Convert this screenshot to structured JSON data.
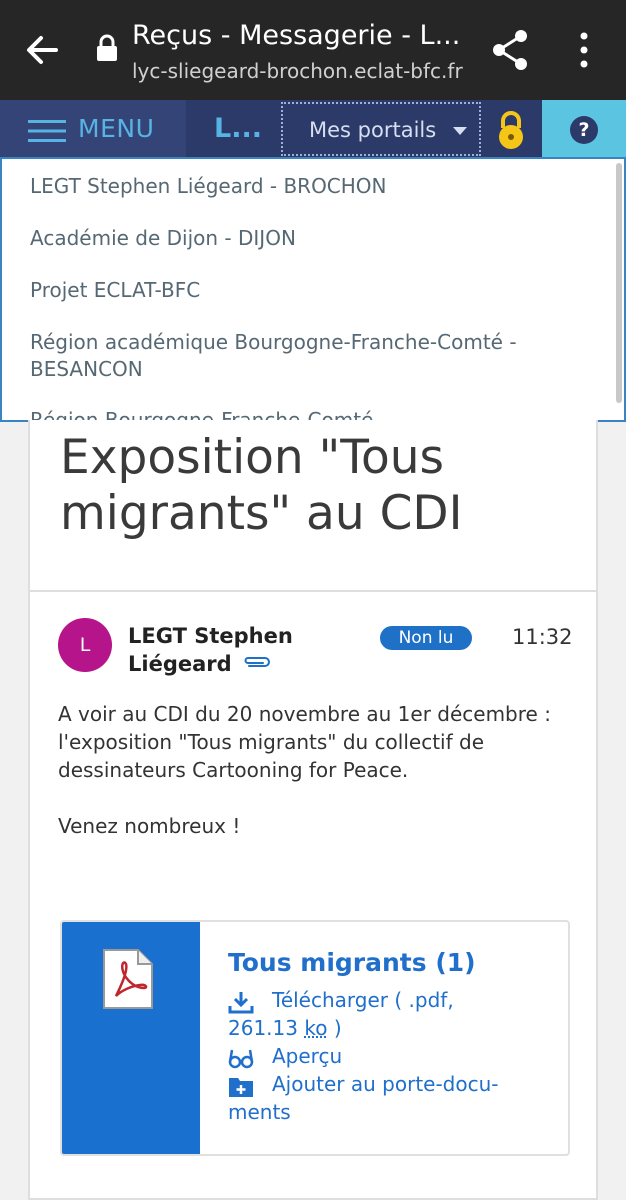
{
  "browser": {
    "title": "Reçus - Messagerie - L...",
    "url": "lyc-sliegeard-brochon.eclat-bfc.fr",
    "icons": [
      "arrow-back-icon",
      "lock-icon",
      "share-icon",
      "more-vert-icon"
    ]
  },
  "navbar": {
    "menu_label": "MENU",
    "short_label": "L...",
    "portals_label": "Mes portails",
    "help_label": "?"
  },
  "portals_dropdown": {
    "items": [
      "LEGT Stephen Liégeard - BROCHON",
      "Académie de Dijon - DIJON",
      "Projet ECLAT-BFC",
      "Région académique Bourgogne-Franche-Comté - BESANCON",
      "Région Bourgogne-Franche-Comté"
    ]
  },
  "message": {
    "subject": "Exposition \"Tous migrants\" au CDI",
    "avatar_initial": "L",
    "sender": "LEGT Stephen Liégeard",
    "status": "Non lu",
    "time": "11:32",
    "body": [
      "A voir au CDI du 20 novembre au 1er décembre : l'exposition \"Tous migrants\" du collectif de dessinateurs Cartooning for Peace.",
      "Venez nombreux !"
    ]
  },
  "attachment": {
    "name": "Tous migrants (1)",
    "download_label": "Télécharger ( .pdf,",
    "size_value": "261.13",
    "size_unit": "ko",
    "size_close": ")",
    "preview_label": "Aperçu",
    "add_label": "Ajouter au porte-docu-",
    "add_label_2": "ments"
  },
  "colors": {
    "chrome_bg": "#262626",
    "navbar_bg": "#2b3a68",
    "accent": "#1f6fcb",
    "avatar": "#b5148a",
    "help_bg": "#5bc4e1"
  }
}
